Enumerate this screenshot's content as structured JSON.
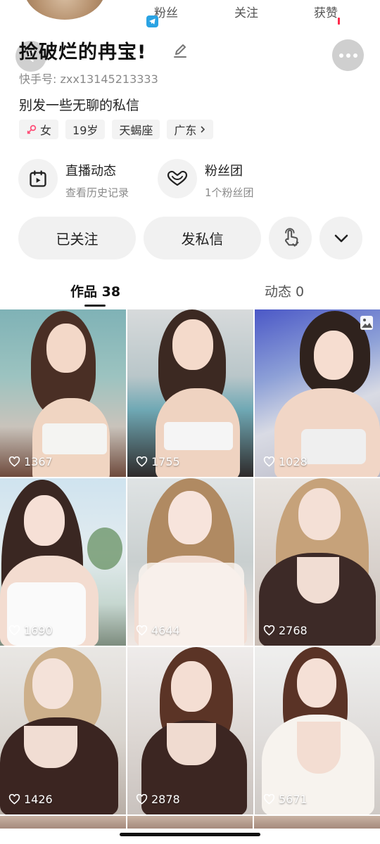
{
  "stats": {
    "fans_label": "粉丝",
    "following_label": "关注",
    "likes_label": "获赞"
  },
  "profile": {
    "name": "捡破烂的冉宝!",
    "kuaishou_id": "快手号: zxx13145213333",
    "bio": "别发一些无聊的私信",
    "tags": {
      "gender": "女",
      "age": "19岁",
      "zodiac": "天蝎座",
      "region": "广东"
    }
  },
  "features": {
    "live": {
      "title": "直播动态",
      "subtitle": "查看历史记录"
    },
    "fanclub": {
      "title": "粉丝团",
      "subtitle": "1个粉丝团"
    }
  },
  "actions": {
    "followed": "已关注",
    "message": "发私信"
  },
  "tabs": {
    "works": "作品 38",
    "moments": "动态 0"
  },
  "posts": [
    {
      "likes": "1367"
    },
    {
      "likes": "1755"
    },
    {
      "likes": "1028"
    },
    {
      "likes": "1690"
    },
    {
      "likes": "4644"
    },
    {
      "likes": "2768"
    },
    {
      "likes": "1426"
    },
    {
      "likes": "2878"
    },
    {
      "likes": "5671"
    }
  ],
  "colors": {
    "accent_red": "#ff2a4b",
    "telegram_blue": "#2aa3e3",
    "button_bg": "#f1f1f1",
    "female_icon": "#ff4f78"
  }
}
